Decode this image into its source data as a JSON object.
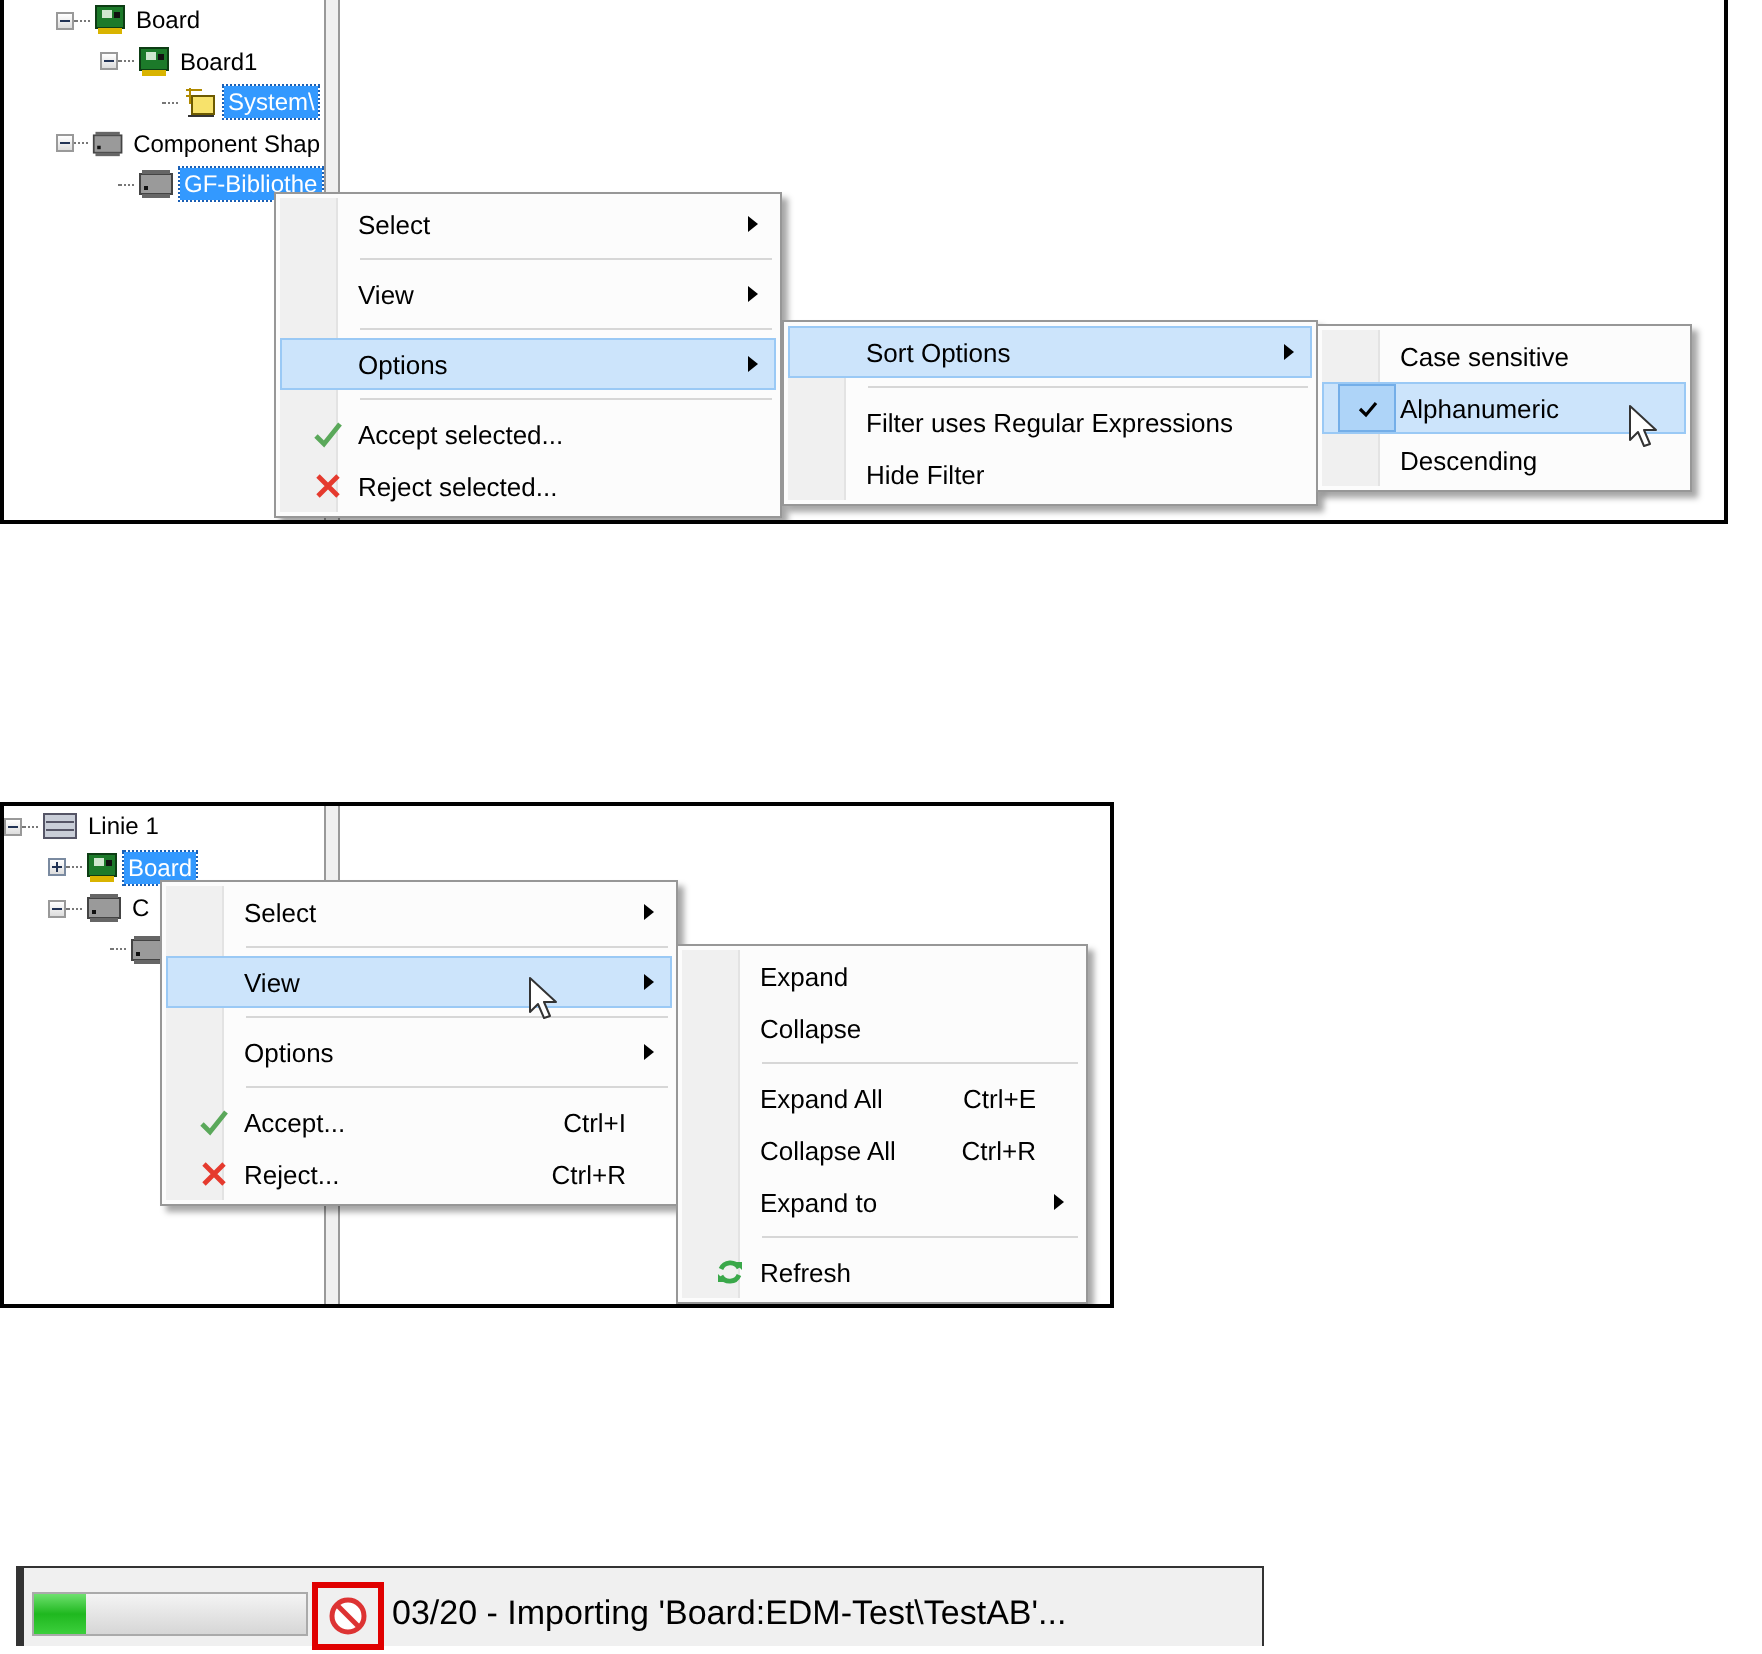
{
  "panels": [
    {
      "tree": [
        {
          "label": "Board",
          "kind": "board",
          "expanded": true,
          "selected": false,
          "children": [
            {
              "label": "Board1",
              "kind": "board",
              "expanded": true,
              "selected": false,
              "children": [
                {
                  "label": "System\\",
                  "kind": "schematic",
                  "selected": true
                }
              ]
            }
          ]
        },
        {
          "label": "Component Shap",
          "kind": "chip",
          "expanded": true,
          "selected": false,
          "children": [
            {
              "label": "GF-Bibliothe",
              "kind": "chip",
              "selected": true
            }
          ]
        }
      ],
      "menus": [
        {
          "items": [
            {
              "kind": "item",
              "label": "Select",
              "submenu": true,
              "selected": false
            },
            {
              "kind": "separator"
            },
            {
              "kind": "item",
              "label": "View",
              "submenu": true,
              "selected": false
            },
            {
              "kind": "separator"
            },
            {
              "kind": "item",
              "label": "Options",
              "submenu": true,
              "selected": true
            },
            {
              "kind": "separator"
            },
            {
              "kind": "accept",
              "label": "Accept selected...",
              "submenu": false,
              "selected": false
            },
            {
              "kind": "reject",
              "label": "Reject selected...",
              "submenu": false,
              "selected": false
            }
          ]
        },
        {
          "items": [
            {
              "kind": "item",
              "label": "Sort Options",
              "submenu": true,
              "selected": true
            },
            {
              "kind": "separator"
            },
            {
              "kind": "item",
              "label": "Filter uses Regular Expressions",
              "submenu": false,
              "selected": false
            },
            {
              "kind": "item",
              "label": "Hide Filter",
              "submenu": false,
              "selected": false
            }
          ]
        },
        {
          "items": [
            {
              "kind": "item",
              "label": "Case sensitive",
              "submenu": false,
              "selected": false,
              "checked": false
            },
            {
              "kind": "item",
              "label": "Alphanumeric",
              "submenu": false,
              "selected": true,
              "checked": true
            },
            {
              "kind": "item",
              "label": "Descending",
              "submenu": false,
              "selected": false,
              "checked": false
            }
          ]
        }
      ]
    },
    {
      "tree": [
        {
          "label": "Linie 1",
          "kind": "rack",
          "expanded": true,
          "selected": false,
          "children": [
            {
              "label": "Board",
              "kind": "board",
              "expanded": false,
              "selected": true
            },
            {
              "label": "C",
              "kind": "chip",
              "expanded": true,
              "selected": false,
              "children": [
                {
                  "kind": "chip",
                  "selected": false
                }
              ]
            }
          ]
        }
      ],
      "menus": [
        {
          "items": [
            {
              "kind": "item",
              "label": "Select",
              "submenu": true,
              "selected": false
            },
            {
              "kind": "separator"
            },
            {
              "kind": "item",
              "label": "View",
              "submenu": true,
              "selected": true
            },
            {
              "kind": "separator"
            },
            {
              "kind": "item",
              "label": "Options",
              "submenu": true,
              "selected": false
            },
            {
              "kind": "separator"
            },
            {
              "kind": "accept",
              "label": "Accept...",
              "shortcut": "Ctrl+I",
              "submenu": false,
              "selected": false
            },
            {
              "kind": "reject",
              "label": "Reject...",
              "shortcut": "Ctrl+R",
              "submenu": false,
              "selected": false
            }
          ]
        },
        {
          "items": [
            {
              "kind": "item",
              "label": "Expand",
              "submenu": false,
              "selected": false
            },
            {
              "kind": "item",
              "label": "Collapse",
              "submenu": false,
              "selected": false
            },
            {
              "kind": "separator"
            },
            {
              "kind": "item",
              "label": "Expand All",
              "shortcut": "Ctrl+E",
              "submenu": false,
              "selected": false
            },
            {
              "kind": "item",
              "label": "Collapse All",
              "shortcut": "Ctrl+R",
              "submenu": false,
              "selected": false
            },
            {
              "kind": "item",
              "label": "Expand to",
              "submenu": true,
              "selected": false
            },
            {
              "kind": "separator"
            },
            {
              "kind": "refresh",
              "label": "Refresh",
              "submenu": false,
              "selected": false
            }
          ]
        }
      ]
    }
  ],
  "status_bar": {
    "level": 0.19,
    "text": "03/20 - Importing 'Board:EDM-Test\\TestAB'..."
  }
}
